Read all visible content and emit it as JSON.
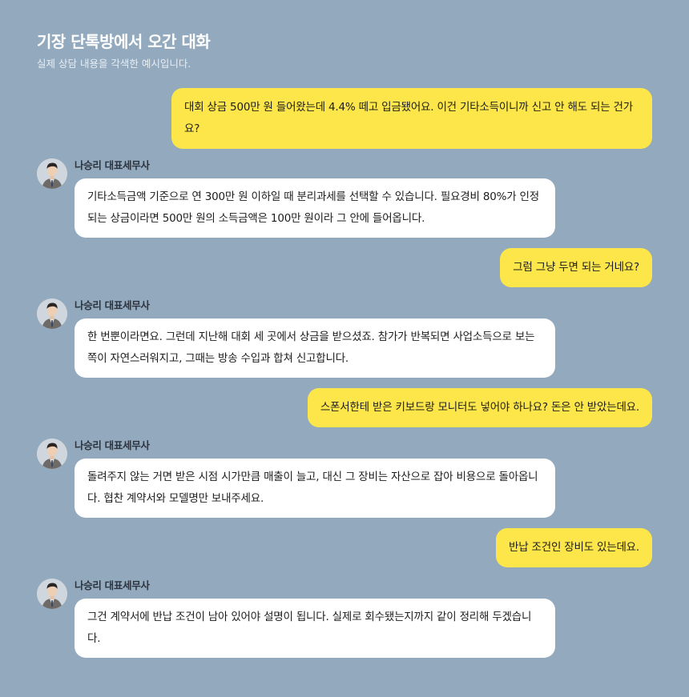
{
  "header": {
    "title": "기장 단톡방에서 오간 대화",
    "subtitle": "실제 상담 내용을 각색한 예시입니다."
  },
  "colors": {
    "background": "#93a9bd",
    "user_bubble": "#fde64a",
    "advisor_bubble": "#ffffff"
  },
  "messages": [
    {
      "sender": "user",
      "text": "대회 상금 500만 원 들어왔는데 4.4% 떼고 입금됐어요. 이건 기타소득이니까 신고 안 해도 되는 건가요?"
    },
    {
      "sender": "advisor",
      "name": "나승리 대표세무사",
      "avatar_icon": "advisor-avatar",
      "text": "기타소득금액 기준으로 연 300만 원 이하일 때 분리과세를 선택할 수 있습니다. 필요경비 80%가 인정되는 상금이라면 500만 원의 소득금액은 100만 원이라 그 안에 들어옵니다."
    },
    {
      "sender": "user",
      "text": "그럼 그냥 두면 되는 거네요?"
    },
    {
      "sender": "advisor",
      "name": "나승리 대표세무사",
      "avatar_icon": "advisor-avatar",
      "text": "한 번뿐이라면요. 그런데 지난해 대회 세 곳에서 상금을 받으셨죠. 참가가 반복되면 사업소득으로 보는 쪽이 자연스러워지고, 그때는 방송 수입과 합쳐 신고합니다."
    },
    {
      "sender": "user",
      "text": "스폰서한테 받은 키보드랑 모니터도 넣어야 하나요? 돈은 안 받았는데요."
    },
    {
      "sender": "advisor",
      "name": "나승리 대표세무사",
      "avatar_icon": "advisor-avatar",
      "text": "돌려주지 않는 거면 받은 시점 시가만큼 매출이 늘고, 대신 그 장비는 자산으로 잡아 비용으로 돌아옵니다. 협찬 계약서와 모델명만 보내주세요."
    },
    {
      "sender": "user",
      "text": "반납 조건인 장비도 있는데요."
    },
    {
      "sender": "advisor",
      "name": "나승리 대표세무사",
      "avatar_icon": "advisor-avatar",
      "text": "그건 계약서에 반납 조건이 남아 있어야 설명이 됩니다. 실제로 회수됐는지까지 같이 정리해 두겠습니다."
    }
  ]
}
